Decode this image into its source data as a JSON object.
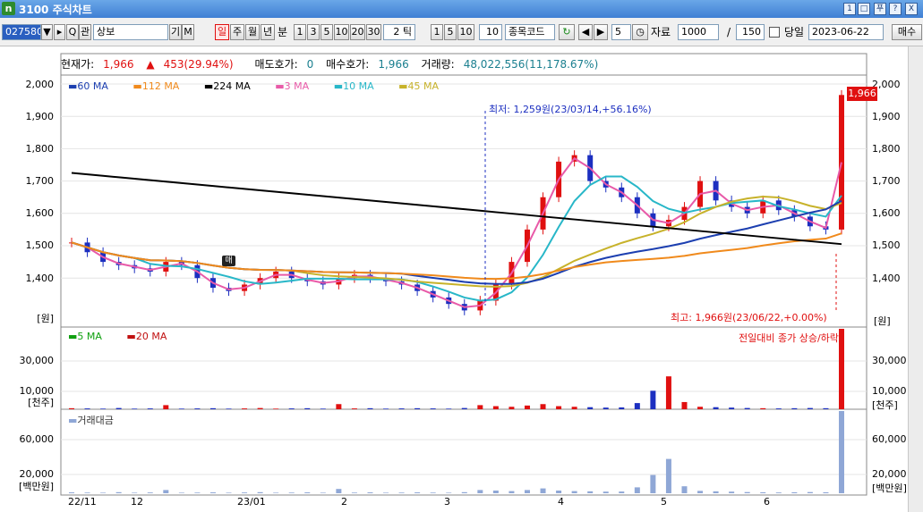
{
  "window": {
    "icon_text": "n",
    "title": "3100 주식차트",
    "buttons": [
      "1",
      "□",
      "푸",
      "?",
      "X"
    ]
  },
  "toolbar": {
    "code": "027580",
    "search_label": "Q",
    "관_label": "관",
    "stock_name": "상보",
    "기_label": "기",
    "M_label": "M",
    "periods": [
      "일",
      "주",
      "월",
      "년",
      "분"
    ],
    "minute_values": [
      "1",
      "3",
      "5",
      "10",
      "20",
      "30"
    ],
    "tick_label": "2 틱",
    "tick_values": [
      "1",
      "5",
      "10"
    ],
    "tick_input": "10",
    "stock_code_label": "종목코드",
    "prev_next": [
      "◀",
      "▶"
    ],
    "page_num": "5",
    "refresh_label": "↻",
    "data_label": "자료",
    "data_count": "1000",
    "slash": "/",
    "count_total": "150",
    "today_label": "당일",
    "date": "2023-06-22",
    "buy_label": "매수"
  },
  "info": {
    "current_label": "현재가:",
    "current_value": "1,966",
    "change": "453(29.94%)",
    "ask_label": "매도호가:",
    "ask_value": "0",
    "bid_label": "매수호가:",
    "bid_value": "1,966",
    "volume_label": "거래량:",
    "volume_value": "48,022,556(11,178.67%)"
  },
  "price_legend": [
    "60 MA",
    "112 MA",
    "224 MA",
    "3 MA",
    "10 MA",
    "45 MA"
  ],
  "volume_legend": [
    "5 MA",
    "20 MA"
  ],
  "amount_legend": [
    "거래대금"
  ],
  "price_axis": [
    "2,000",
    "1,900",
    "1,800",
    "1,700",
    "1,600",
    "1,500",
    "1,400"
  ],
  "price_unit": "[원]",
  "volume_axis": [
    "30,000",
    "10,000"
  ],
  "volume_unit": "[천주]",
  "amount_axis": [
    "60,000",
    "20,000"
  ],
  "amount_unit": "[백만원]",
  "annotations": {
    "low": "최저: 1,259원(23/03/14,+56.16%)",
    "high": "최고: 1,966원(23/06/22,+0.00%)",
    "volume_note": "전일대비 종가 상승/하락",
    "buy_marker": "매"
  },
  "last_price_tag": "1,966",
  "x_axis": [
    "22/11",
    "12",
    "23/01",
    "2",
    "3",
    "4",
    "5",
    "6"
  ],
  "colors": {
    "ma60": "#1c3fb0",
    "ma112": "#f08a1c",
    "ma224": "#000000",
    "ma3": "#e85aa8",
    "ma10": "#28b7c8",
    "ma45": "#c7b22a",
    "up": "#e01010",
    "down": "#1c2fc0",
    "vol5": "#10a010",
    "vol20": "#c01010",
    "amount": "#8fa7d6"
  },
  "chart_data": [
    {
      "type": "candlestick",
      "title": "",
      "ylim": [
        1300,
        2000
      ],
      "x": [
        "22/11",
        "12",
        "23/01",
        "2",
        "3",
        "4",
        "5",
        "6"
      ],
      "series": [
        {
          "name": "60 MA"
        },
        {
          "name": "112 MA"
        },
        {
          "name": "224 MA"
        },
        {
          "name": "3 MA"
        },
        {
          "name": "10 MA"
        },
        {
          "name": "45 MA"
        }
      ],
      "close": [
        1510,
        1480,
        1450,
        1440,
        1430,
        1420,
        1450,
        1440,
        1400,
        1370,
        1360,
        1380,
        1400,
        1420,
        1400,
        1390,
        1380,
        1400,
        1410,
        1400,
        1390,
        1380,
        1360,
        1340,
        1320,
        1300,
        1330,
        1380,
        1450,
        1550,
        1650,
        1760,
        1780,
        1700,
        1680,
        1650,
        1600,
        1560,
        1580,
        1620,
        1700,
        1640,
        1620,
        1600,
        1640,
        1610,
        1590,
        1560,
        1550,
        1966
      ]
    },
    {
      "type": "bar",
      "title": "",
      "ylim": [
        0,
        40000
      ],
      "series": [
        {
          "name": "5 MA"
        },
        {
          "name": "20 MA"
        }
      ],
      "values": [
        500,
        400,
        300,
        600,
        300,
        400,
        2000,
        300,
        400,
        500,
        300,
        400,
        600,
        300,
        400,
        500,
        300,
        2500,
        400,
        500,
        300,
        400,
        500,
        400,
        300,
        600,
        2000,
        1500,
        1200,
        1800,
        2500,
        1500,
        1200,
        1000,
        800,
        900,
        3000,
        9000,
        16000,
        3500,
        1200,
        1000,
        800,
        600,
        500,
        400,
        500,
        600,
        500,
        48000
      ]
    },
    {
      "type": "bar",
      "title": "",
      "ylim": [
        0,
        80000
      ],
      "series": [
        {
          "name": "거래대금"
        }
      ],
      "values": [
        800,
        600,
        500,
        1000,
        500,
        700,
        3000,
        500,
        600,
        800,
        500,
        700,
        1000,
        500,
        600,
        800,
        500,
        4000,
        600,
        800,
        500,
        600,
        800,
        600,
        500,
        1000,
        3000,
        2500,
        2000,
        3000,
        4500,
        2500,
        2000,
        1800,
        1500,
        1600,
        5500,
        17000,
        32000,
        6500,
        2200,
        1800,
        1500,
        1100,
        900,
        700,
        900,
        1100,
        900,
        94000
      ]
    }
  ]
}
